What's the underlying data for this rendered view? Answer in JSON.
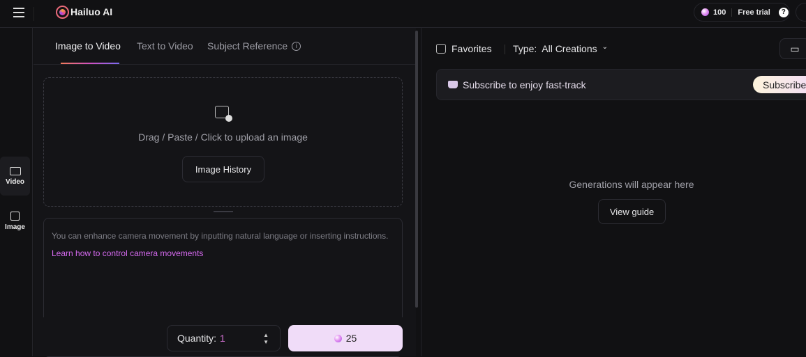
{
  "header": {
    "logo_text": "Hailuo AI",
    "credits": "100",
    "free_trial": "Free trial"
  },
  "rail": {
    "items": [
      {
        "label": "Video",
        "icon": "video-add-icon"
      },
      {
        "label": "Image",
        "icon": "image-add-icon"
      }
    ]
  },
  "left": {
    "tabs": [
      {
        "label": "Image to Video",
        "active": true
      },
      {
        "label": "Text to Video"
      },
      {
        "label": "Subject Reference"
      }
    ],
    "upload_text": "Drag / Paste / Click to upload an image",
    "image_history": "Image History",
    "prompt_placeholder": "You can enhance camera movement by inputting natural language or inserting instructions.",
    "prompt_link": "Learn how to control camera movements",
    "quantity_label": "Quantity:",
    "quantity_value": "1",
    "generate_cost": "25"
  },
  "right": {
    "favorites": "Favorites",
    "type_label": "Type:",
    "type_value": "All Creations",
    "subscribe_text": "Subscribe to enjoy fast-track",
    "subscribe_button": "Subscribe",
    "empty_text": "Generations will appear here",
    "view_guide": "View guide"
  },
  "colors": {
    "accent": "#e05fd6",
    "generate_bg": "#f0dcf8",
    "link": "#d66af0"
  }
}
